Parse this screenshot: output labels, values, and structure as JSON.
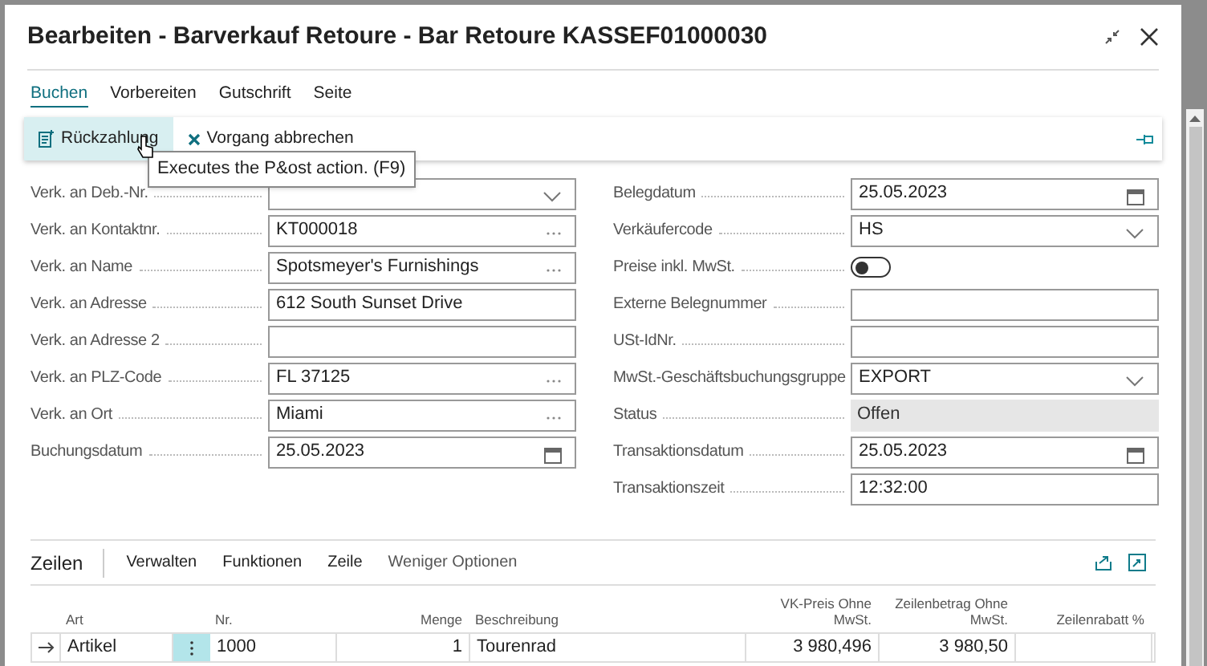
{
  "window": {
    "title": "Bearbeiten - Barverkauf Retoure - Bar Retoure KASSEF01000030"
  },
  "tabs": [
    {
      "label": "Buchen",
      "selected": true
    },
    {
      "label": "Vorbereiten",
      "selected": false
    },
    {
      "label": "Gutschrift",
      "selected": false
    },
    {
      "label": "Seite",
      "selected": false
    }
  ],
  "actions": [
    {
      "label": "Rückzahlung",
      "kind": "post",
      "hovered": true
    },
    {
      "label": "Vorgang abbrechen",
      "kind": "cancel",
      "hovered": false
    }
  ],
  "tooltip": "Executes the P&ost action. (F9)",
  "left_fields": [
    {
      "label": "Verk. an Deb.-Nr.",
      "kind": "dropdown"
    },
    {
      "label": "Verk. an Kontaktnr.",
      "kind": "lookup",
      "value": "KT000018"
    },
    {
      "label": "Verk. an Name",
      "kind": "lookup",
      "value": "Spotsmeyer's Furnishings"
    },
    {
      "label": "Verk. an Adresse",
      "kind": "text",
      "value": "612 South Sunset Drive"
    },
    {
      "label": "Verk. an Adresse 2",
      "kind": "text"
    },
    {
      "label": "Verk. an PLZ-Code",
      "kind": "lookup",
      "value": "FL 37125"
    },
    {
      "label": "Verk. an Ort",
      "kind": "lookup",
      "value": "Miami"
    },
    {
      "label": "Buchungsdatum",
      "kind": "date",
      "value": "25.05.2023"
    }
  ],
  "right_fields": [
    {
      "label": "Belegdatum",
      "kind": "date",
      "value": "25.05.2023"
    },
    {
      "label": "Verkäufercode",
      "kind": "dropdown",
      "value": "HS"
    },
    {
      "label": "Preise inkl. MwSt.",
      "kind": "toggle",
      "on": false
    },
    {
      "label": "Externe Belegnummer",
      "kind": "text"
    },
    {
      "label": "USt-IdNr.",
      "kind": "text"
    },
    {
      "label": "MwSt.-Geschäftsbuchungsgruppe",
      "kind": "dropdown",
      "value": "EXPORT"
    },
    {
      "label": "Status",
      "kind": "readonly",
      "value": "Offen"
    },
    {
      "label": "Transaktionsdatum",
      "kind": "date",
      "value": "25.05.2023"
    },
    {
      "label": "Transaktionszeit",
      "kind": "text",
      "value": "12:32:00"
    }
  ],
  "lines": {
    "title": "Zeilen",
    "menu": [
      "Verwalten",
      "Funktionen",
      "Zeile",
      "Weniger Optionen"
    ],
    "columns": [
      "Art",
      "Nr.",
      "Menge",
      "Beschreibung",
      "VK-Preis Ohne MwSt.",
      "Zeilenbetrag Ohne MwSt.",
      "Zeilenrabatt %"
    ],
    "rows": [
      {
        "selected": true,
        "cells": [
          "Artikel",
          "1000",
          "1",
          "Tourenrad",
          "3 980,496",
          "3 980,50",
          ""
        ]
      }
    ]
  }
}
